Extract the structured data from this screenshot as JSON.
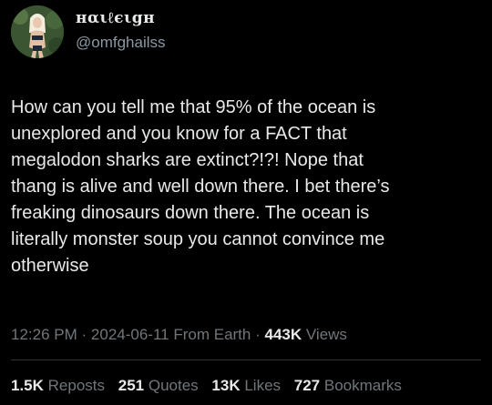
{
  "author": {
    "display_name": "нαιℓєιgн",
    "handle": "@omfghailss"
  },
  "tweet": {
    "text": "How can you tell me that 95% of the ocean is\nunexplored and you know for a FACT that\nmegalodon sharks are extinct?!?! Nope that\nthang is alive and well down there. I bet there’s\nfreaking dinosaurs down there. The ocean is\nliterally monster soup you cannot convince me\notherwise",
    "time": "12:26 PM",
    "separator": "·",
    "date": "2024-06-11",
    "source": "From Earth",
    "views_count": "443K",
    "views_label": "Views"
  },
  "stats": {
    "reposts_count": "1.5K",
    "reposts_label": "Reposts",
    "quotes_count": "251",
    "quotes_label": "Quotes",
    "likes_count": "13K",
    "likes_label": "Likes",
    "bookmarks_count": "727",
    "bookmarks_label": "Bookmarks"
  },
  "colors": {
    "background": "#000000",
    "primary_text": "#e7e9ea",
    "secondary_text": "#71767b",
    "divider": "#2f3336"
  }
}
